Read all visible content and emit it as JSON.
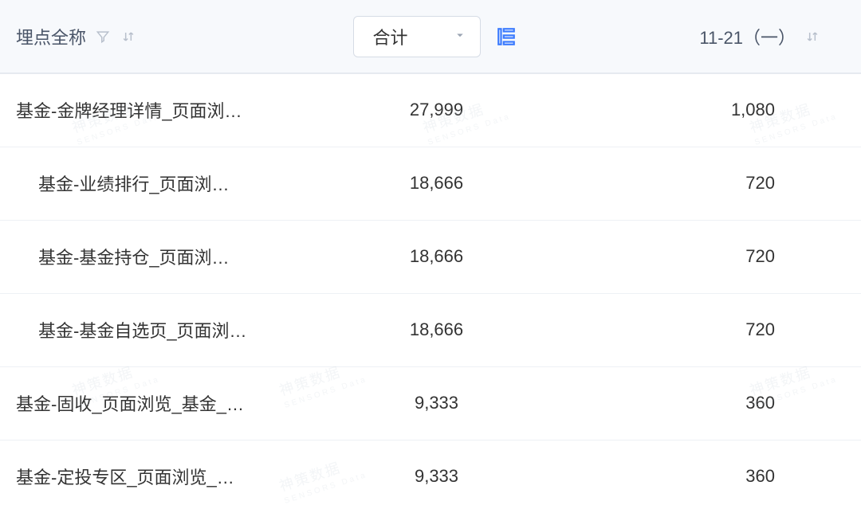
{
  "header": {
    "col1_label": "埋点全称",
    "col2_dropdown_label": "合计",
    "col3_label": "11-21（一）"
  },
  "rows": [
    {
      "name": "基金-金牌经理详情_页面浏…",
      "total": "27,999",
      "date_value": "1,080",
      "indent": 0
    },
    {
      "name": "基金-业绩排行_页面浏…",
      "total": "18,666",
      "date_value": "720",
      "indent": 1
    },
    {
      "name": "基金-基金持仓_页面浏…",
      "total": "18,666",
      "date_value": "720",
      "indent": 1
    },
    {
      "name": "基金-基金自选页_页面浏…",
      "total": "18,666",
      "date_value": "720",
      "indent": 1
    },
    {
      "name": "基金-固收_页面浏览_基金_…",
      "total": "9,333",
      "date_value": "360",
      "indent": 0
    },
    {
      "name": "基金-定投专区_页面浏览_…",
      "total": "9,333",
      "date_value": "360",
      "indent": 0
    }
  ],
  "watermark_text": "神策数据"
}
